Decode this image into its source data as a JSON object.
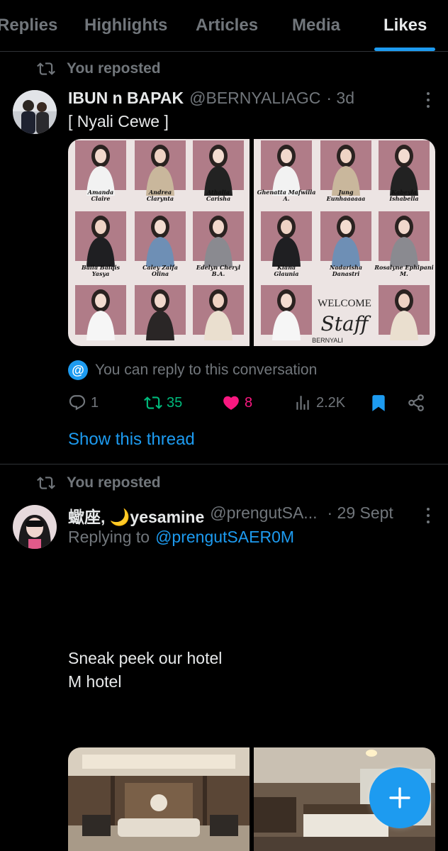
{
  "tabs": [
    {
      "label": "Replies"
    },
    {
      "label": "Highlights"
    },
    {
      "label": "Articles"
    },
    {
      "label": "Media"
    },
    {
      "label": "Likes",
      "active": true
    }
  ],
  "colors": {
    "accent": "#1d9bf0",
    "retweet": "#00ba7c",
    "like": "#f91880",
    "dim": "#71767b"
  },
  "post1": {
    "repost_label": "You reposted",
    "name": "IBUN n BAPAK",
    "handle": "@BERNYALIAGC",
    "time": "· 3d",
    "text": "[ Nyali Cewe ]",
    "image1_names": [
      "Amanda Claire",
      "Andrea Clarynta",
      "Athalia Carisha",
      "Baila Balqis Yasya",
      "Caley Zalfa Olina",
      "Edelyn Cheryl B.A."
    ],
    "image2_names": [
      "Ghenatta Mafwilla A.",
      "Jung Eunhaaaaaa",
      "Kabeyla Ishabella",
      "Kiana Glaunia",
      "Nadarisha Danastri",
      "Rosalyne Ephipani M."
    ],
    "image2_welcome": "WELCOME",
    "image2_staff": "Staff",
    "image2_brand": "BERNYALI",
    "reply_note": "You can reply to this conversation",
    "replies": "1",
    "reposts": "35",
    "likes": "8",
    "views": "2.2K",
    "bookmarked": true,
    "show_thread": "Show this thread"
  },
  "post2": {
    "repost_label": "You reposted",
    "name": "蠍座, 🌙yesamine",
    "handle": "@prengutSA...",
    "time": "· 29 Sept",
    "replying_prefix": "Replying to",
    "replying_to": "@prengutSAER0M",
    "text": "Sneak peek our hotel\nM hotel"
  },
  "fab": {
    "icon": "plus-icon"
  }
}
